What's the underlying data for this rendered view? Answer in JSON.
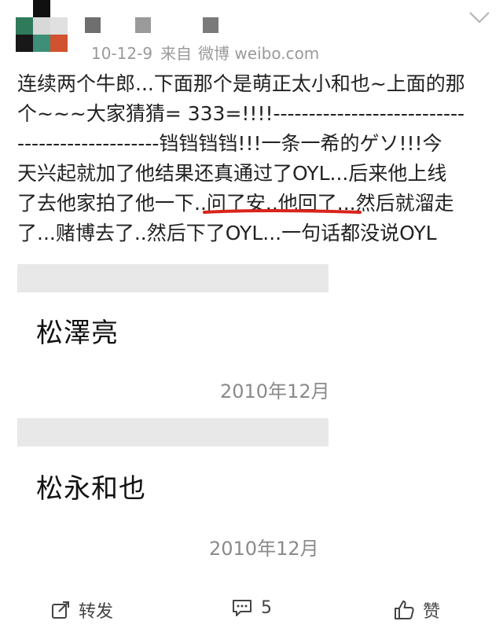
{
  "post": {
    "meta": {
      "date": "10-12-9",
      "source_prefix": "来自",
      "source": "微博 weibo.com"
    },
    "content_lines": [
      "连续两个牛郎...下面那个是萌正太小和也~上面的那",
      "个~~~大家猜猜= 333=!!!!---------------------------",
      "--------------------铛铛铛铛!!!一条一希的ゲソ!!!今",
      "天兴起就加了他结果还真通过了OYL...后来他上线",
      "了去他家拍了他一下..问了安..他回了...然后就溜走",
      "了...赌博去了..然后下了OYL...一句话都没说OYL"
    ],
    "embedded_cards": [
      {
        "name": "松澤亮",
        "date": "2010年12月"
      },
      {
        "name": "松永和也",
        "date": "2010年12月"
      }
    ],
    "footer": {
      "repost_label": "转发",
      "comment_count": "5",
      "like_label": "赞"
    }
  },
  "colors": {
    "highlight_underline": "#d9241c",
    "meta_text": "#9a9a9a",
    "card_bar": "#e8e8e8"
  }
}
